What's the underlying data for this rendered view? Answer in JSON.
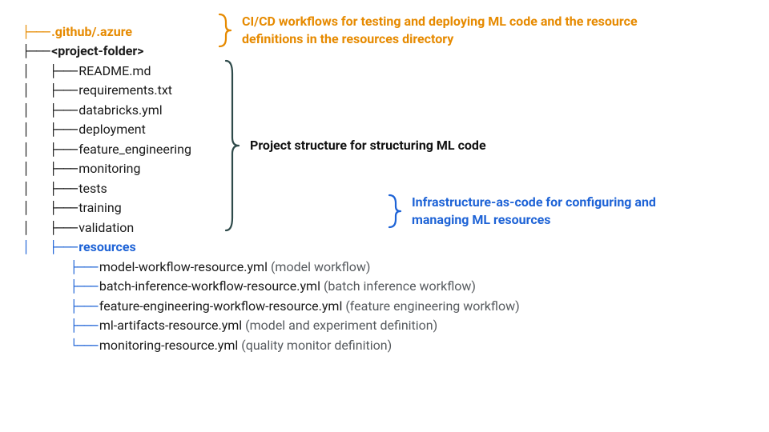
{
  "colors": {
    "orange": "#e68a00",
    "blue": "#1e63d6",
    "darkTeal": "#2e4a4a",
    "text": "#1a1a1a"
  },
  "tree": {
    "github": ".github/.azure",
    "project": "<project-folder>",
    "children": [
      "README.md",
      "requirements.txt",
      "databricks.yml",
      "deployment",
      "feature_engineering",
      "monitoring",
      "tests",
      "training",
      "validation"
    ],
    "resources_label": "resources",
    "resources": [
      {
        "file": "model-workflow-resource.yml",
        "desc": "(model workflow)"
      },
      {
        "file": "batch-inference-workflow-resource.yml",
        "desc": "(batch inference workflow)"
      },
      {
        "file": "feature-engineering-workflow-resource.yml",
        "desc": "(feature engineering workflow)"
      },
      {
        "file": "ml-artifacts-resource.yml",
        "desc": "(model and experiment definition)"
      },
      {
        "file": "monitoring-resource.yml",
        "desc": "(quality monitor definition)"
      }
    ]
  },
  "annotations": {
    "cicd": "CI/CD workflows for testing and deploying ML code and the resource definitions in the resources directory",
    "project": "Project structure for structuring ML code",
    "iac": "Infrastructure-as-code for configuring and managing ML resources"
  }
}
